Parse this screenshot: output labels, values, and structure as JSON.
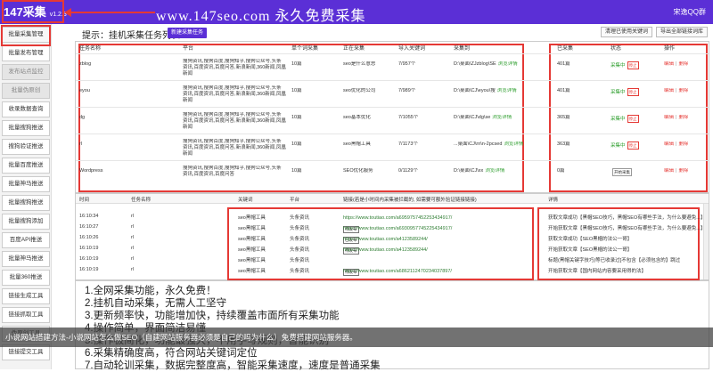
{
  "header": {
    "app_title": "147采集",
    "version": "v1.2.3",
    "banner": "www.147seo.com   永久免费采集",
    "qq_label": "宋逸QQ群"
  },
  "sidebar": {
    "items": [
      {
        "label": "批量采集管理"
      },
      {
        "label": "批量发布管理"
      },
      {
        "label": "发布站点监控"
      },
      {
        "label": "批量伪原创"
      },
      {
        "label": "收录数据查询"
      },
      {
        "label": "批量搜狗推送"
      },
      {
        "label": "搜狗验证推送"
      },
      {
        "label": "批量百度推送"
      },
      {
        "label": "批量神马推送"
      },
      {
        "label": "批量搜狗推送"
      },
      {
        "label": "批量搜狗添加"
      },
      {
        "label": "百度API推送"
      },
      {
        "label": "批量神马推送"
      },
      {
        "label": "批量360推送"
      },
      {
        "label": "链接生成工具"
      },
      {
        "label": "链接抓取工具"
      },
      {
        "label": "伪原创工具"
      },
      {
        "label": "链接提交工具"
      }
    ]
  },
  "toolbar": {
    "hint_label": "提示：挂机采集任务列表",
    "new_task": "新建采集任务",
    "btn_clear_keywords": "清理已使用关键词",
    "btn_export": "导出全部链接词库"
  },
  "tasks": {
    "headers": [
      "任务名称",
      "平台",
      "单个词采集",
      "正在采集",
      "导入关键词",
      "采集到",
      "已采集",
      "状态",
      "操作"
    ],
    "rows": [
      {
        "name": "zblog",
        "platform": "搜狗资讯,搜狗百度,搜狗知乎,搜狗公众号,头条资讯,百度资讯,百度问答,新浪新闻,360新闻,凤凰新闻",
        "per": "10篇",
        "current": "seo是什么意思",
        "imported": "7/957个",
        "path": "D:\\桌面\\ZJzblog\\SE",
        "path_link": "浏览详情",
        "collected": "401篇",
        "status": "采集中",
        "status_tag": "停止",
        "op_edit": "编辑",
        "op_delete": "删除"
      },
      {
        "name": "eyou",
        "platform": "搜狗资讯,搜狗百度,搜狗知乎,搜狗公众号,头条资讯,百度资讯,百度问答,新浪新闻,360新闻,凤凰新闻",
        "per": "10篇",
        "current": "seo优化的公司",
        "imported": "7/989个",
        "path": "D:\\桌面\\CJ\\eyou\\搜",
        "path_link": "浏览详情",
        "collected": "401篇",
        "status": "采集中",
        "status_tag": "停止",
        "op_edit": "编辑",
        "op_delete": "删除"
      },
      {
        "name": "dg",
        "platform": "搜狗资讯,搜狗百度,搜狗知乎,搜狗公众号,头条资讯,百度资讯,百度问答,新浪新闻,360新闻,凤凰新闻",
        "per": "10篇",
        "current": "seo基本优化",
        "imported": "7/1055个",
        "path": "D:\\桌面\\CJ\\dg\\se",
        "path_link": "浏览详情",
        "collected": "365篇",
        "status": "采集中",
        "status_tag": "停止",
        "op_edit": "编辑",
        "op_delete": "删除"
      },
      {
        "name": "rl",
        "platform": "搜狗资讯,搜狗百度,搜狗知乎,搜狗公众号,头条资讯,百度资讯,百度问答,新浪新闻,360新闻,凤凰新闻",
        "per": "10篇",
        "current": "seo黑帽工具",
        "imported": "7/1173个",
        "path": "...桌面\\CJ\\rn\\n-2pcsed",
        "path_link": "浏览详情",
        "collected": "363篇",
        "status": "采集中",
        "status_tag": "停止",
        "op_edit": "编辑",
        "op_delete": "删除"
      },
      {
        "name": "Wordpress",
        "platform": "搜狗资讯,搜狗百度,搜狗知乎,搜狗公众号,头条资讯,百度资讯,百度问答",
        "per": "10篇",
        "current": "SEO优化服务",
        "imported": "0/1129个",
        "path": "D:\\桌面\\CJ\\xx",
        "path_link": "浏览详情",
        "collected": "0篇",
        "status": "",
        "status_tag": "开始采集",
        "op_edit": "编辑",
        "op_delete": "删除"
      }
    ]
  },
  "log": {
    "headers": [
      "时间",
      "任务名称",
      "关键词",
      "平台",
      "链接(若是小时间内采集被拦截的, 如需要可额外验证链接链接)",
      "详情"
    ],
    "rows": [
      {
        "time": "16:10:34",
        "task": "rl",
        "keyword": "seo黑帽工具",
        "platform": "头条资讯",
        "tag": "",
        "url": "https://www.toutiao.com/a6959757452253434917/",
        "detail": "获取文章成功【黑帽SEO技巧，黑帽SEO有哪些手法，为什么要避免...】"
      },
      {
        "time": "16:10:27",
        "task": "rl",
        "keyword": "seo黑帽工具",
        "platform": "头条资讯",
        "tag": "待发布",
        "url": "https://www.toutiao.com/a6930957745225434917/",
        "detail": "开始获取文章【黑帽SEO技巧，黑帽SEO有哪些手法，为什么要避免...】"
      },
      {
        "time": "16:10:26",
        "task": "rl",
        "keyword": "seo黑帽工具",
        "platform": "头条资讯",
        "tag": "已发布",
        "url": "https://www.toutiao.com/a4123589244/",
        "detail": "获取文章成功【SEO黑帽的法公一哥】"
      },
      {
        "time": "16:10:19",
        "task": "rl",
        "keyword": "seo黑帽工具",
        "platform": "头条资讯",
        "tag": "待发布",
        "url": "https://www.toutiao.com/a4123589244/",
        "detail": "开始获取文章【SEO黑帽的法公一哥】"
      },
      {
        "time": "16:10:19",
        "task": "rl",
        "keyword": "seo黑帽工具",
        "platform": "头条资讯",
        "tag": "",
        "url": "",
        "detail": "标题(黑帽关键字技巧)等已收录过[不包含【必须包含的】跳过"
      },
      {
        "time": "16:10:19",
        "task": "rl",
        "keyword": "seo黑帽工具",
        "platform": "头条资讯",
        "tag": "待发布",
        "url": "https://www.toutiao.com/a6862112470234037897/",
        "detail": "开始获取文章【国内网站内容要采用得的法】"
      }
    ]
  },
  "features": {
    "lines": [
      "1.全网采集功能，永久免费！",
      "2.挂机自动采集，无需人工坚守",
      "3.更新频率快，功能增加快，持续覆盖市面所有采集功能",
      "4.操作简单，界面简洁易懂",
      "5.操作极简化，功能最强大，不用手写规则，智能识别",
      "6.采集精确度高，符合网站关键词定位",
      "7.自动轮训采集，数据完整度高，智能采集速度，速度是普通采集"
    ]
  },
  "caption": "小说网站搭建方法-小说网站怎么做SEO（自建网站服务器必须是自己的吗为什么）免费搭建网站服务器。",
  "colors": {
    "brand": "#5b2fd6",
    "highlight": "#e53935",
    "link": "#2e9e2e"
  }
}
